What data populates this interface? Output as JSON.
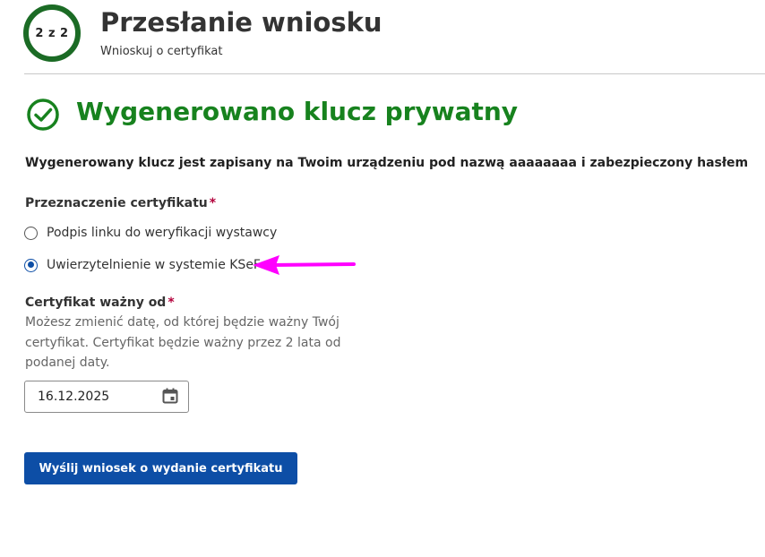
{
  "header": {
    "step_indicator": "2 z 2",
    "title": "Przesłanie wniosku",
    "subtitle": "Wnioskuj o certyfikat"
  },
  "success": {
    "icon": "check-circle-icon",
    "title": "Wygenerowano klucz prywatny",
    "color": "#17821e"
  },
  "info_text": "Wygenerowany klucz jest zapisany na Twoim urządzeniu pod nazwą aaaaaaaa i zabezpieczony hasłem",
  "purpose": {
    "label": "Przeznaczenie certyfikatu",
    "required_marker": "*",
    "options": [
      {
        "label": "Podpis linku do weryfikacji wystawcy",
        "selected": false
      },
      {
        "label": "Uwierzytelnienie w systemie KSeF",
        "selected": true
      }
    ]
  },
  "valid_from": {
    "label": "Certyfikat ważny od",
    "required_marker": "*",
    "help": "Możesz zmienić datę, od której będzie ważny Twój certyfikat. Certyfikat będzie ważny przez 2 lata od podanej daty.",
    "value": "16.12.2025",
    "icon": "calendar-icon"
  },
  "submit_label": "Wyślij wniosek o wydanie certyfikatu",
  "colors": {
    "primary": "#0d4ea6",
    "step_ring": "#1b6b25",
    "required": "#b3003b",
    "annotation_arrow": "#ff00ff"
  }
}
